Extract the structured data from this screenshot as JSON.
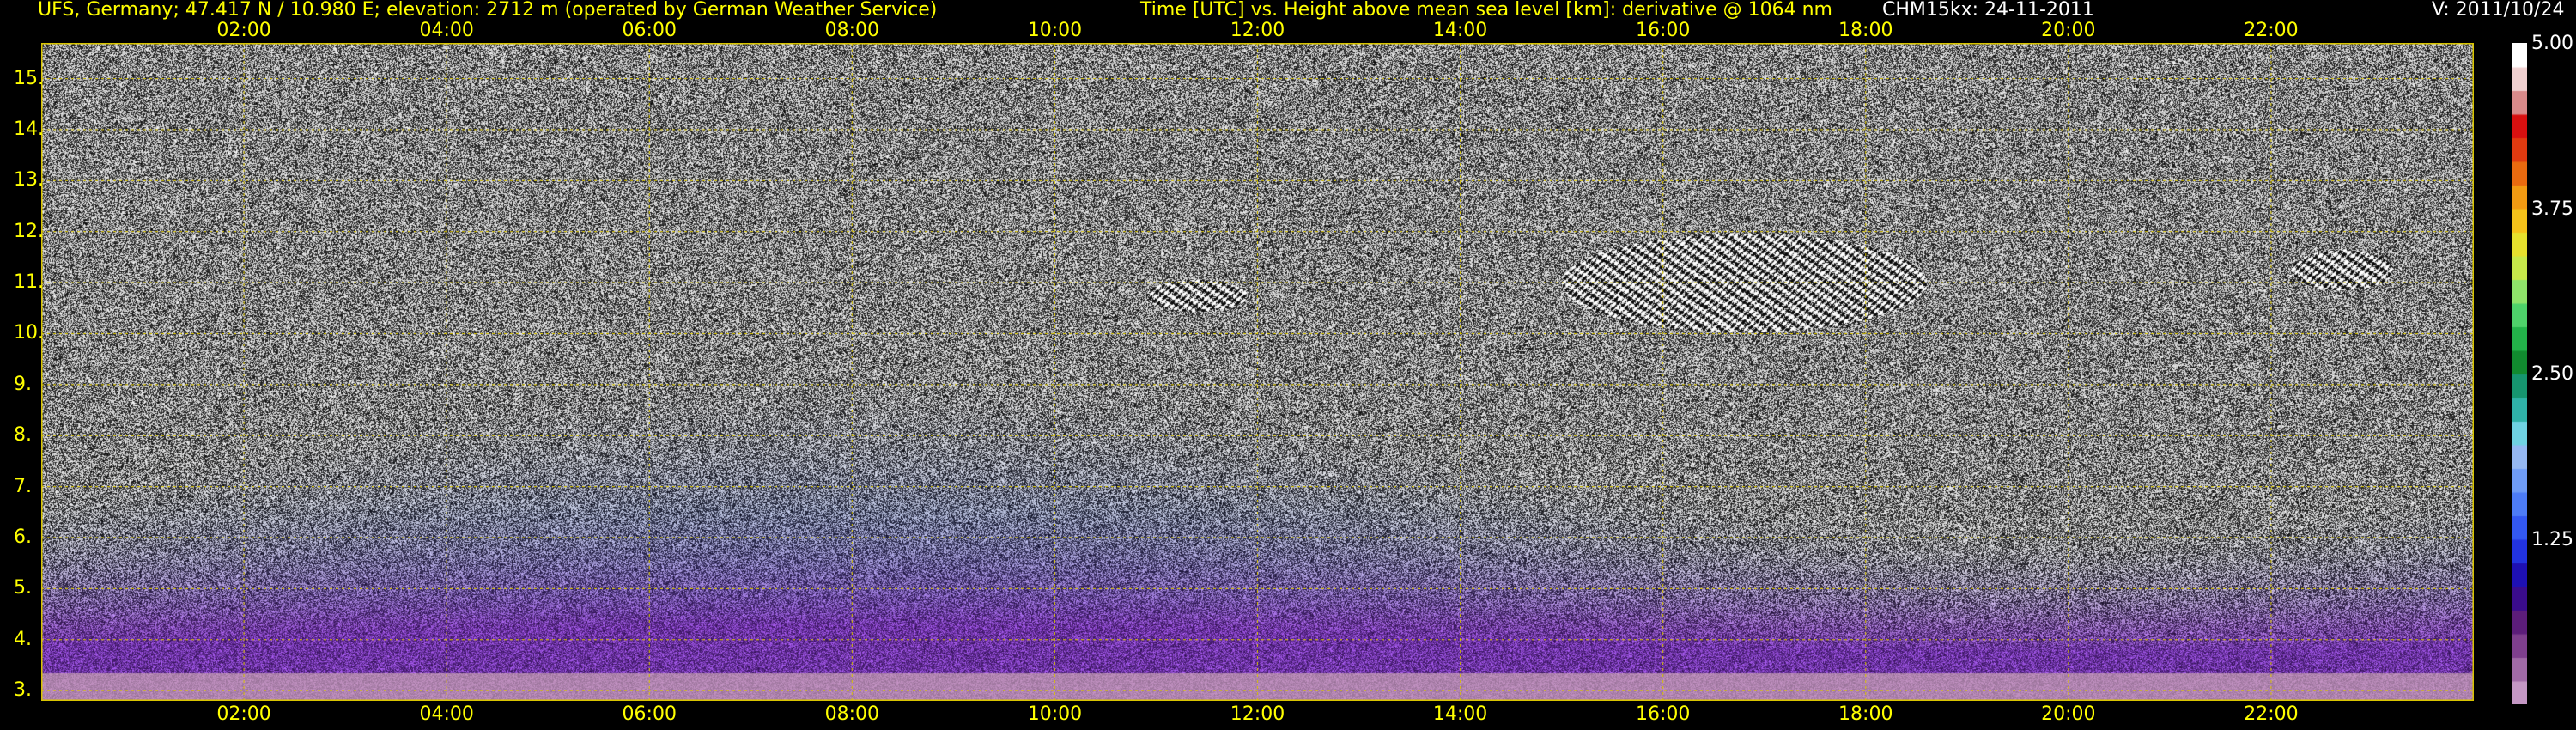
{
  "header": {
    "station": "UFS, Germany; 47.417 N / 10.980 E; elevation: 2712 m  (operated by German Weather Service)",
    "description": "Time [UTC] vs. Height above mean sea level [km]: derivative @ 1064 nm",
    "instrument_date": "CHM15kx: 24-11-2011",
    "version": "V: 2011/10/24"
  },
  "colorbar": {
    "labels": [
      "5.00",
      "3.75",
      "2.50",
      "1.25"
    ],
    "stops": [
      "#c497c4",
      "#a06aa6",
      "#7f3f8e",
      "#5c1d7a",
      "#3a0c8c",
      "#1e10b4",
      "#2233e0",
      "#3358f2",
      "#4d7cf7",
      "#6f9cf7",
      "#95b8f2",
      "#6fd2e2",
      "#2fb2a8",
      "#16956f",
      "#118a2f",
      "#23b34a",
      "#4ed26a",
      "#8fe36a",
      "#c6e84a",
      "#e6e02d",
      "#f5c21a",
      "#f29a12",
      "#ea6a0f",
      "#e03a10",
      "#d81010",
      "#d98a8a",
      "#f0d0d0",
      "#ffffff"
    ]
  },
  "chart_data": {
    "type": "heatmap",
    "title": "Time [UTC] vs. Height above mean sea level [km]: derivative @ 1064 nm",
    "xlabel": "Time [UTC]",
    "ylabel": "Height above mean sea level [km]",
    "x_ticks": [
      "02:00",
      "04:00",
      "06:00",
      "08:00",
      "10:00",
      "12:00",
      "14:00",
      "16:00",
      "18:00",
      "20:00",
      "22:00"
    ],
    "y_ticks": [
      "3.",
      "4.",
      "5.",
      "6.",
      "7.",
      "8.",
      "9.",
      "10.",
      "11.",
      "12.",
      "13.",
      "14.",
      "15."
    ],
    "x_range_hours": [
      0,
      24
    ],
    "y_range_km": [
      2.8,
      15.7
    ],
    "color_range": [
      0,
      5
    ],
    "grid": true,
    "features": [
      {
        "name": "cloud layer",
        "t_start_h": 15.0,
        "t_end_h": 18.6,
        "z_bottom_km": 9.9,
        "z_top_km": 12.1
      },
      {
        "name": "cloud",
        "t_start_h": 10.9,
        "t_end_h": 11.9,
        "z_bottom_km": 10.4,
        "z_top_km": 11.1
      },
      {
        "name": "cloud",
        "t_start_h": 22.2,
        "t_end_h": 23.2,
        "z_bottom_km": 10.8,
        "z_top_km": 11.7
      }
    ]
  }
}
